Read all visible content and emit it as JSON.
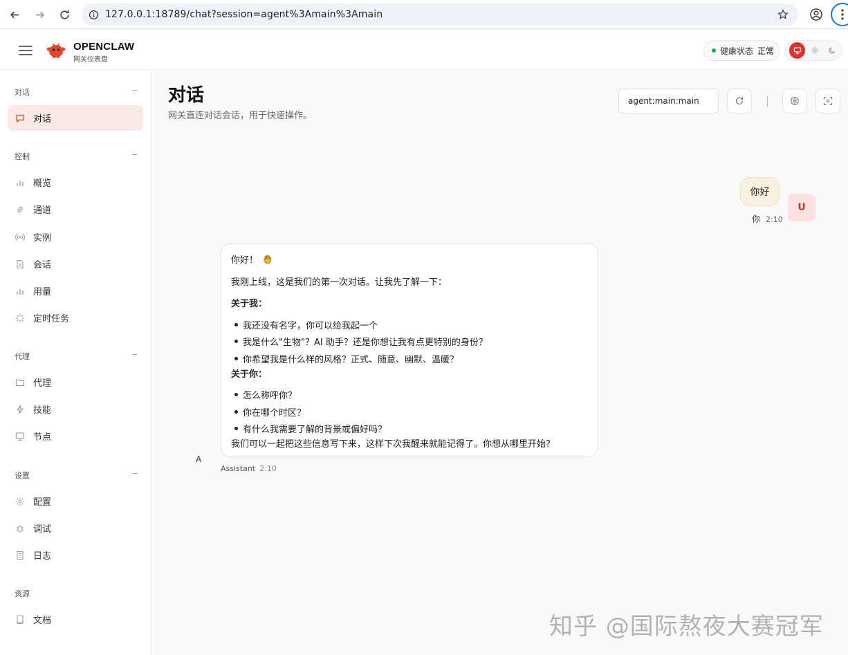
{
  "browser": {
    "url": "127.0.0.1:18789/chat?session=agent%3Amain%3Amain"
  },
  "header": {
    "brand_name": "OPENCLAW",
    "brand_sub": "网关仪表盘",
    "health_label": "健康状态",
    "health_value": "正常",
    "accent_color": "#e03131"
  },
  "sidebar": {
    "groups": [
      {
        "title": "对话",
        "collapse": "−",
        "items": [
          {
            "label": "对话",
            "icon": "chat-icon",
            "active": true
          }
        ]
      },
      {
        "title": "控制",
        "collapse": "−",
        "items": [
          {
            "label": "概览",
            "icon": "bar-chart-icon"
          },
          {
            "label": "通道",
            "icon": "link-icon"
          },
          {
            "label": "实例",
            "icon": "broadcast-icon"
          },
          {
            "label": "会话",
            "icon": "document-icon"
          },
          {
            "label": "用量",
            "icon": "bar-chart-icon"
          },
          {
            "label": "定时任务",
            "icon": "loader-icon"
          }
        ]
      },
      {
        "title": "代理",
        "collapse": "−",
        "items": [
          {
            "label": "代理",
            "icon": "folder-icon"
          },
          {
            "label": "技能",
            "icon": "lightning-icon"
          },
          {
            "label": "节点",
            "icon": "monitor-icon"
          }
        ]
      },
      {
        "title": "设置",
        "collapse": "−",
        "items": [
          {
            "label": "配置",
            "icon": "gear-icon"
          },
          {
            "label": "调试",
            "icon": "bug-icon"
          },
          {
            "label": "日志",
            "icon": "log-icon"
          }
        ]
      },
      {
        "title": "资源",
        "items": [
          {
            "label": "文档",
            "icon": "book-icon"
          }
        ]
      }
    ]
  },
  "main": {
    "title": "对话",
    "subtitle": "网关直连对话会话，用于快速操作。",
    "session_value": "agent:main:main"
  },
  "messages": {
    "user": {
      "text": "你好",
      "avatar": "U",
      "who": "你",
      "time": "2:10"
    },
    "assistant": {
      "avatar": "A",
      "greeting": "你好！",
      "intro": "我刚上线，这是我们的第一次对话。让我先了解一下：",
      "about_me_title": "关于我：",
      "about_me": [
        "我还没有名字，你可以给我起一个",
        "我是什么\"生物\"？AI 助手？还是你想让我有点更特别的身份？",
        "你希望我是什么样的风格？正式、随意、幽默、温暖？"
      ],
      "about_you_title": "关于你：",
      "about_you": [
        "怎么称呼你？",
        "你在哪个时区？",
        "有什么我需要了解的背景或偏好吗？"
      ],
      "closing": "我们可以一起把这些信息写下来，这样下次我醒来就能记得了。你想从哪里开始？",
      "who": "Assistant",
      "time": "2:10"
    }
  },
  "watermark": "知乎 @国际熬夜大赛冠军"
}
